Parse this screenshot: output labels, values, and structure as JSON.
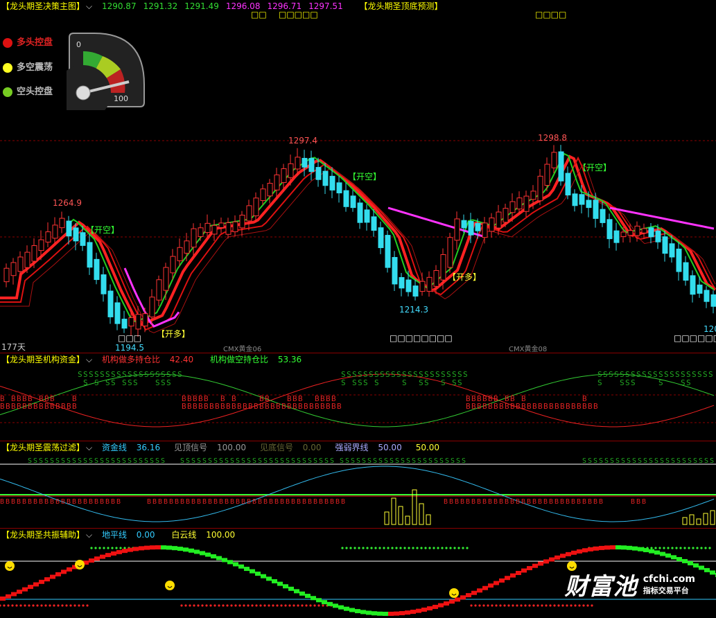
{
  "panel1": {
    "title": "【龙头期圣决策主图】",
    "values": [
      "1290.87",
      "1291.32",
      "1291.49",
      "1296.08",
      "1296.71",
      "1297.51"
    ],
    "value_colors": [
      "#33dd33",
      "#33dd33",
      "#33dd33",
      "#ff33ff",
      "#ff33ff",
      "#ff33ff"
    ],
    "title2": "【龙头期圣顶底预测】",
    "marks_top": [
      "□□",
      "□□□□□"
    ],
    "mark_top_right": "□□□□",
    "legend": [
      {
        "label": "多头控盘",
        "color": "#dd1111"
      },
      {
        "label": "多空震荡",
        "color": "#ffff22"
      },
      {
        "label": "空头控盘",
        "color": "#77cc22"
      }
    ],
    "gauge_min": "0",
    "gauge_max": "100",
    "price_labels": [
      "1264.9",
      "1297.4",
      "1298.8",
      "1194.5",
      "1214.3",
      "120"
    ],
    "signals": {
      "open_short": "【开空】",
      "open_long": "【开多】"
    },
    "bottom_marks": [
      "□□□",
      "□□□□□□□□",
      "□□□□□□□"
    ],
    "days": "177天",
    "contract1": "CMX黄金06",
    "contract2": "CMX黄金08"
  },
  "panel2": {
    "title": "【龙头期圣机构资金】",
    "long_label": "机构做多持仓比",
    "long_value": "42.40",
    "short_label": "机构做空持仓比",
    "short_value": "53.36"
  },
  "panel3": {
    "title": "【龙头期圣震荡过滤】",
    "items": [
      {
        "label": "资金线",
        "value": "36.16",
        "lc": "#33ccff",
        "vc": "#33ccff"
      },
      {
        "label": "见顶信号",
        "value": "100.00",
        "lc": "#999999",
        "vc": "#999999"
      },
      {
        "label": "见底信号",
        "value": "0.00",
        "lc": "#666633",
        "vc": "#666633"
      },
      {
        "label": "强弱界线",
        "value": "50.00",
        "lc": "#aaaaff",
        "vc": "#aaaaff"
      },
      {
        "label": "",
        "value": "50.00",
        "lc": "#33ff33",
        "vc": "#ffff33"
      }
    ]
  },
  "panel4": {
    "title": "【龙头期圣共振辅助】",
    "ground_label": "地平线",
    "ground_value": "0.00",
    "cloud_label": "白云线",
    "cloud_value": "100.00"
  },
  "watermark": {
    "brand": "财富池",
    "url": "cfchi.com",
    "slogan": "指标交易平台"
  },
  "chart_data": {
    "type": "candlestick",
    "title": "【龙头期圣决策主图】",
    "annotated_highs_lows": [
      {
        "label": "1264.9",
        "type": "high"
      },
      {
        "label": "1194.5",
        "type": "low"
      },
      {
        "label": "1297.4",
        "type": "high"
      },
      {
        "label": "1214.3",
        "type": "low"
      },
      {
        "label": "1298.8",
        "type": "high"
      }
    ],
    "signals": [
      {
        "type": "开空"
      },
      {
        "type": "开多"
      },
      {
        "type": "开空"
      },
      {
        "type": "开多"
      },
      {
        "type": "开空"
      }
    ]
  }
}
